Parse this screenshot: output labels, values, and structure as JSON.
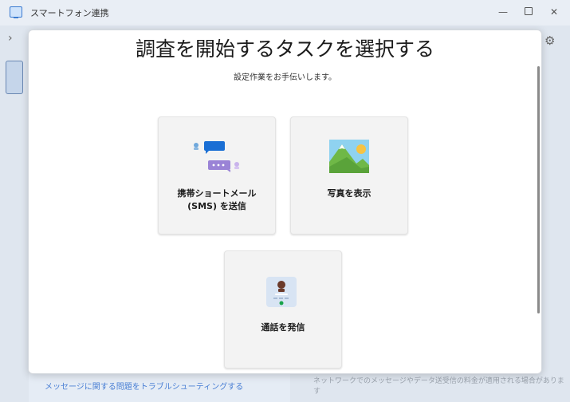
{
  "window": {
    "title": "スマートフォン連携",
    "minimize": "—",
    "maximize": "",
    "close": "✕"
  },
  "background": {
    "chevron": "›",
    "gear": "⚙",
    "troubleshoot_link": "メッセージに関する問題をトラブルシューティングする",
    "carrier_note": "ネットワークでのメッセージやデータ送受信の料金が適用される場合があります"
  },
  "dialog": {
    "title": "調査を開始するタスクを選択する",
    "subtitle": "設定作業をお手伝いします。",
    "cards": {
      "sms": {
        "line1": "携帯ショートメール",
        "line2": "(SMS) を送信"
      },
      "photos": {
        "label": "写真を表示"
      },
      "call": {
        "label": "通話を発信"
      }
    }
  },
  "colors": {
    "accent_blue": "#1a6fd4",
    "bubble_purple": "#9a83d6",
    "photo_sky": "#8fd2f0",
    "photo_hill": "#6fb847"
  },
  "icons": [
    "sms-illustration",
    "photo-illustration",
    "call-illustration",
    "gear-icon",
    "chevron-right-icon"
  ]
}
